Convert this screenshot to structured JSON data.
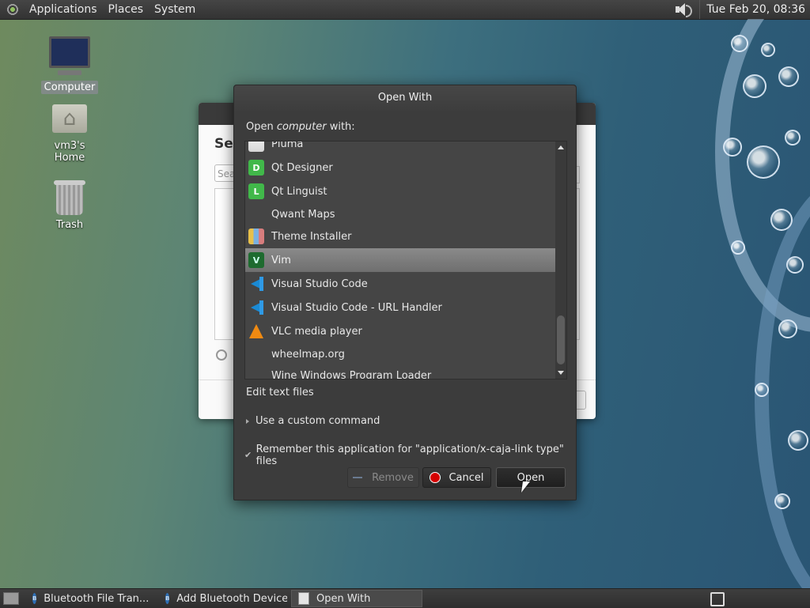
{
  "top_panel": {
    "menus": [
      "Applications",
      "Places",
      "System"
    ],
    "clock": "Tue Feb 20, 08:36"
  },
  "desktop": {
    "icons": [
      {
        "label": "Computer"
      },
      {
        "label": "vm3's Home"
      },
      {
        "label": "Trash"
      }
    ]
  },
  "background_window": {
    "heading": "Se",
    "search_placeholder": "Sea"
  },
  "dialog": {
    "title": "Open With",
    "prompt_prefix": "Open ",
    "prompt_target": "computer",
    "prompt_suffix": " with:",
    "apps": [
      {
        "label": "Pluma",
        "icon": "pluma-icon",
        "selected": false
      },
      {
        "label": "Qt Designer",
        "icon": "qt-designer-icon",
        "badge": "D",
        "selected": false
      },
      {
        "label": "Qt Linguist",
        "icon": "qt-linguist-icon",
        "badge": "L",
        "selected": false
      },
      {
        "label": "Qwant Maps",
        "icon": "blank-icon",
        "selected": false
      },
      {
        "label": "Theme Installer",
        "icon": "theme-installer-icon",
        "selected": false
      },
      {
        "label": "Vim",
        "icon": "vim-icon",
        "selected": true
      },
      {
        "label": "Visual Studio Code",
        "icon": "vscode-icon",
        "selected": false
      },
      {
        "label": "Visual Studio Code - URL Handler",
        "icon": "vscode-icon",
        "selected": false
      },
      {
        "label": "VLC media player",
        "icon": "vlc-icon",
        "selected": false
      },
      {
        "label": "wheelmap.org",
        "icon": "blank-icon",
        "selected": false
      },
      {
        "label": "Wine Windows Program Loader",
        "icon": "blank-icon",
        "selected": false
      }
    ],
    "description": "Edit text files",
    "custom_command_label": "Use a custom command",
    "remember_label": "Remember this application for \"application/x-caja-link type\" files",
    "remember_checked": true,
    "buttons": {
      "remove": "Remove",
      "cancel": "Cancel",
      "open": "Open"
    }
  },
  "taskbar": {
    "tasks": [
      {
        "label": "Bluetooth File Tran...",
        "icon": "bluetooth-icon",
        "active": false
      },
      {
        "label": "Add Bluetooth Device",
        "icon": "bluetooth-icon",
        "active": false
      },
      {
        "label": "Open With",
        "icon": "window-icon",
        "active": true
      }
    ]
  }
}
